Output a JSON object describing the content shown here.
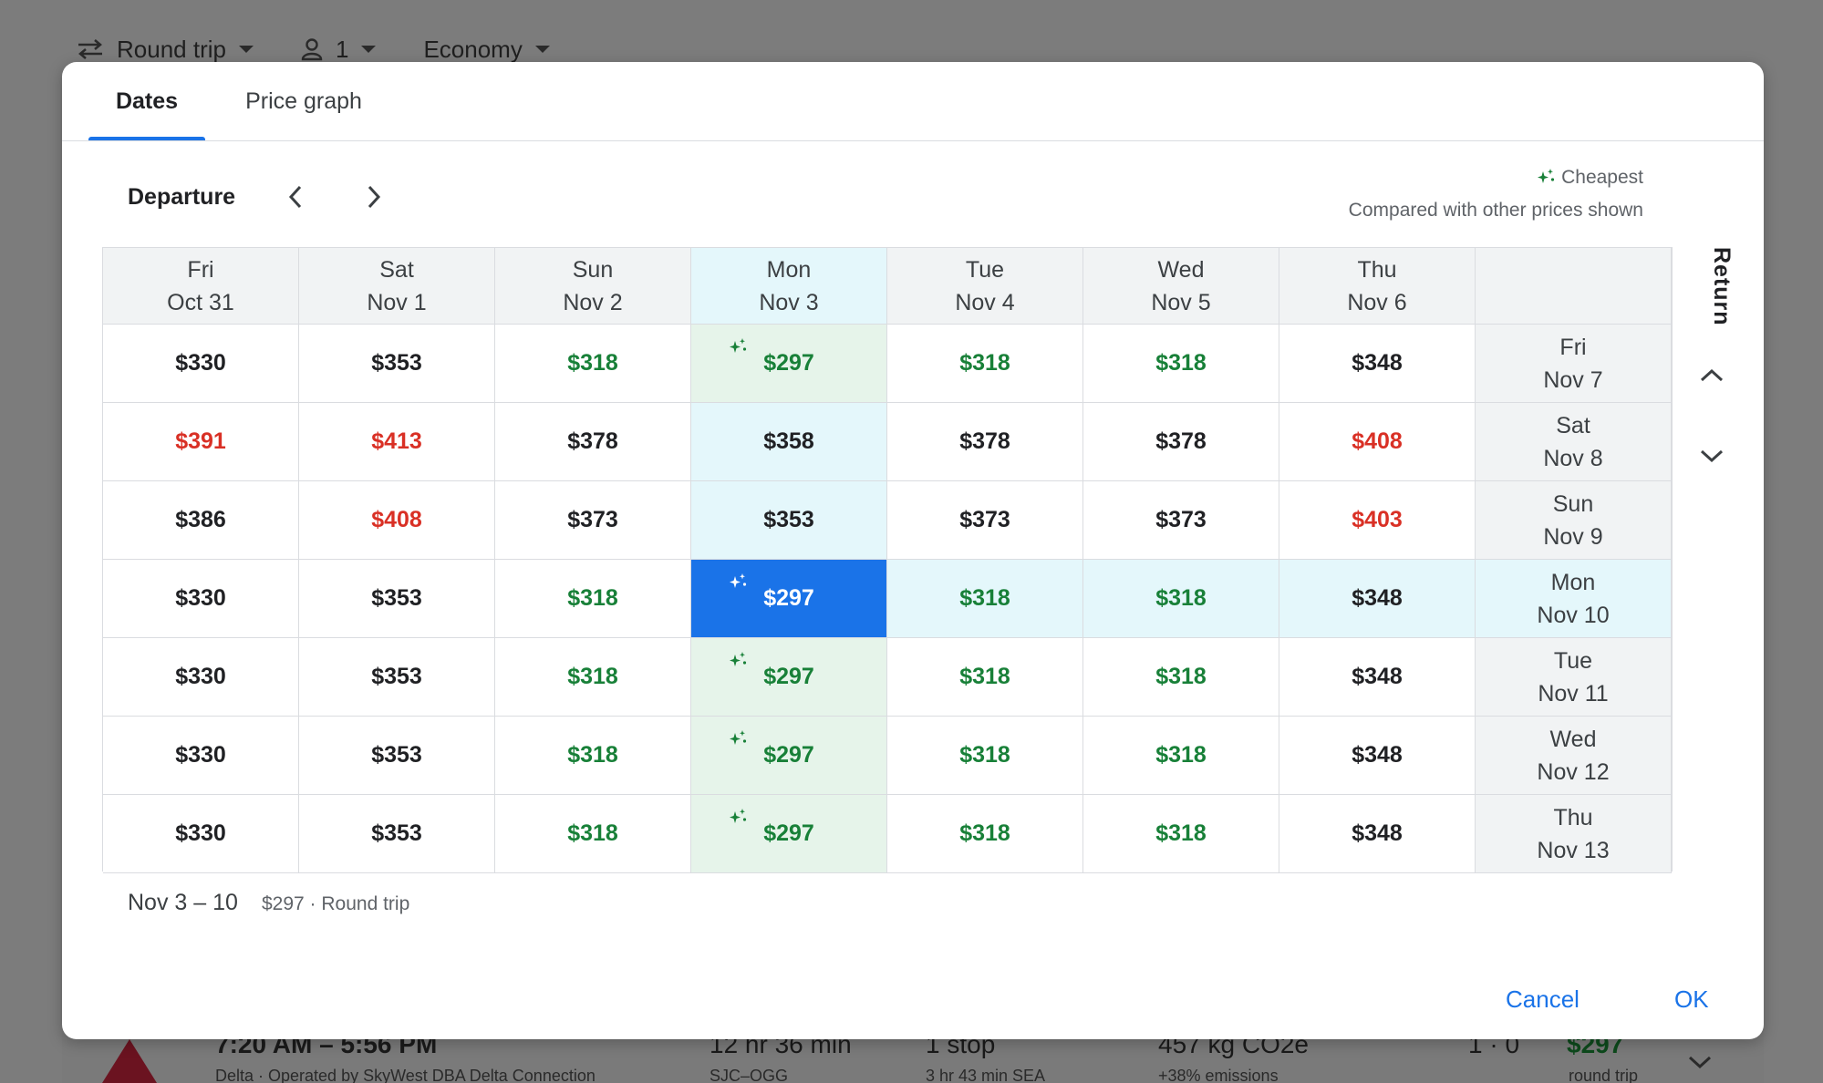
{
  "background": {
    "trip_type": "Round trip",
    "passengers": "1",
    "cabin": "Economy",
    "flight_row": {
      "times": "7:20 AM – 5:56 PM",
      "airline": "Delta · Operated by SkyWest DBA Delta Connection",
      "duration": "12 hr 36 min",
      "route": "SJC–OGG",
      "stops": "1 stop",
      "layover": "3 hr 43 min SEA",
      "emissions": "457 kg CO2e",
      "emissions_sub": "+38% emissions",
      "bags": "1 · 0",
      "price": "$297",
      "price_sub": "round trip"
    }
  },
  "dialog": {
    "tabs": [
      "Dates",
      "Price graph"
    ],
    "active_tab": "Dates",
    "departure_label": "Departure",
    "return_label": "Return",
    "legend": {
      "label": "Cheapest",
      "sub": "Compared with other prices shown"
    },
    "departure_columns": [
      {
        "dow": "Fri",
        "date": "Oct 31"
      },
      {
        "dow": "Sat",
        "date": "Nov 1"
      },
      {
        "dow": "Sun",
        "date": "Nov 2"
      },
      {
        "dow": "Mon",
        "date": "Nov 3"
      },
      {
        "dow": "Tue",
        "date": "Nov 4"
      },
      {
        "dow": "Wed",
        "date": "Nov 5"
      },
      {
        "dow": "Thu",
        "date": "Nov 6"
      }
    ],
    "return_rows": [
      {
        "dow": "Fri",
        "date": "Nov 7",
        "prices": [
          {
            "v": "$330",
            "c": "black"
          },
          {
            "v": "$353",
            "c": "black"
          },
          {
            "v": "$318",
            "c": "green"
          },
          {
            "v": "$297",
            "c": "green",
            "cheapest": true
          },
          {
            "v": "$318",
            "c": "green"
          },
          {
            "v": "$318",
            "c": "green"
          },
          {
            "v": "$348",
            "c": "black"
          }
        ]
      },
      {
        "dow": "Sat",
        "date": "Nov 8",
        "prices": [
          {
            "v": "$391",
            "c": "red"
          },
          {
            "v": "$413",
            "c": "red"
          },
          {
            "v": "$378",
            "c": "black"
          },
          {
            "v": "$358",
            "c": "black"
          },
          {
            "v": "$378",
            "c": "black"
          },
          {
            "v": "$378",
            "c": "black"
          },
          {
            "v": "$408",
            "c": "red"
          }
        ]
      },
      {
        "dow": "Sun",
        "date": "Nov 9",
        "prices": [
          {
            "v": "$386",
            "c": "black"
          },
          {
            "v": "$408",
            "c": "red"
          },
          {
            "v": "$373",
            "c": "black"
          },
          {
            "v": "$353",
            "c": "black"
          },
          {
            "v": "$373",
            "c": "black"
          },
          {
            "v": "$373",
            "c": "black"
          },
          {
            "v": "$403",
            "c": "red"
          }
        ]
      },
      {
        "dow": "Mon",
        "date": "Nov 10",
        "prices": [
          {
            "v": "$330",
            "c": "black"
          },
          {
            "v": "$353",
            "c": "black"
          },
          {
            "v": "$318",
            "c": "green"
          },
          {
            "v": "$297",
            "c": "green",
            "cheapest": true,
            "selected": true
          },
          {
            "v": "$318",
            "c": "green"
          },
          {
            "v": "$318",
            "c": "green"
          },
          {
            "v": "$348",
            "c": "black"
          }
        ]
      },
      {
        "dow": "Tue",
        "date": "Nov 11",
        "prices": [
          {
            "v": "$330",
            "c": "black"
          },
          {
            "v": "$353",
            "c": "black"
          },
          {
            "v": "$318",
            "c": "green"
          },
          {
            "v": "$297",
            "c": "green",
            "cheapest": true
          },
          {
            "v": "$318",
            "c": "green"
          },
          {
            "v": "$318",
            "c": "green"
          },
          {
            "v": "$348",
            "c": "black"
          }
        ]
      },
      {
        "dow": "Wed",
        "date": "Nov 12",
        "prices": [
          {
            "v": "$330",
            "c": "black"
          },
          {
            "v": "$353",
            "c": "black"
          },
          {
            "v": "$318",
            "c": "green"
          },
          {
            "v": "$297",
            "c": "green",
            "cheapest": true
          },
          {
            "v": "$318",
            "c": "green"
          },
          {
            "v": "$318",
            "c": "green"
          },
          {
            "v": "$348",
            "c": "black"
          }
        ]
      },
      {
        "dow": "Thu",
        "date": "Nov 13",
        "prices": [
          {
            "v": "$330",
            "c": "black"
          },
          {
            "v": "$353",
            "c": "black"
          },
          {
            "v": "$318",
            "c": "green"
          },
          {
            "v": "$297",
            "c": "green",
            "cheapest": true
          },
          {
            "v": "$318",
            "c": "green"
          },
          {
            "v": "$318",
            "c": "green"
          },
          {
            "v": "$348",
            "c": "black"
          }
        ]
      }
    ],
    "selected_departure_index": 3,
    "selected_return_index": 3,
    "footer": {
      "dates": "Nov 3 – 10",
      "summary": "$297 · Round trip"
    },
    "buttons": {
      "cancel": "Cancel",
      "ok": "OK"
    }
  },
  "colors": {
    "accent": "#1a73e8",
    "cheap_green": "#188038",
    "expensive_red": "#d93025",
    "highlight": "#e4f7fb",
    "cheapest_bg": "#e6f4ea"
  }
}
